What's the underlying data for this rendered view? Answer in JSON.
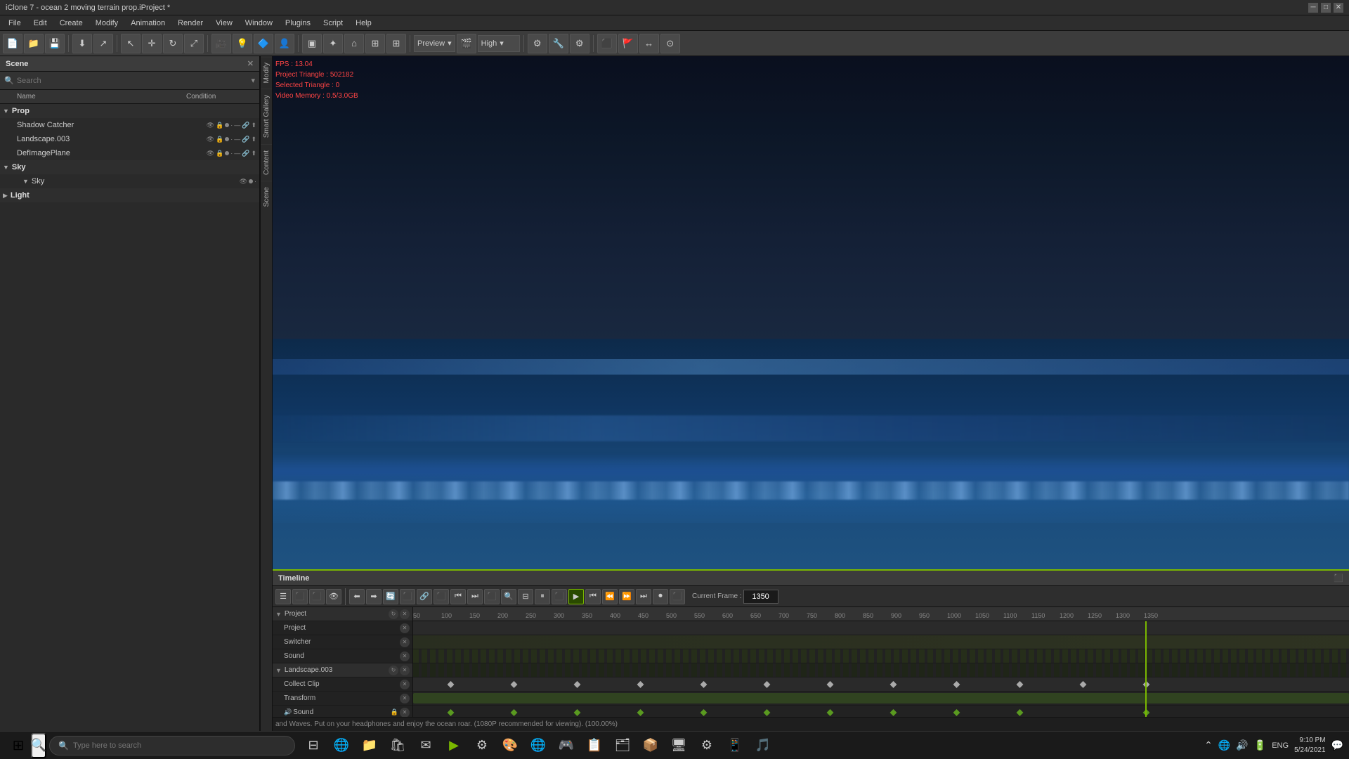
{
  "titleBar": {
    "title": "iClone 7 - ocean 2 moving terrain prop.iProject *",
    "minBtn": "─",
    "maxBtn": "□",
    "closeBtn": "✕"
  },
  "menuBar": {
    "items": [
      "File",
      "Edit",
      "Create",
      "Modify",
      "Animation",
      "Render",
      "View",
      "Window",
      "Plugins",
      "Script",
      "Help"
    ]
  },
  "toolbar": {
    "previewLabel": "Preview",
    "qualityLabel": "High"
  },
  "scenePanel": {
    "title": "Scene",
    "searchPlaceholder": "Search",
    "columnName": "Name",
    "columnCondition": "Condition",
    "groups": [
      {
        "name": "Prop",
        "items": [
          "Shadow Catcher",
          "Landscape.003",
          "DefImagePlane"
        ]
      },
      {
        "name": "Sky",
        "items": [
          "Sky"
        ]
      },
      {
        "name": "Light",
        "items": []
      }
    ]
  },
  "sideTabs": [
    "Modify",
    "Smart Gallery",
    "Content",
    "Scene"
  ],
  "viewport": {
    "fps": "FPS : 13.04",
    "projectTriangle": "Project Triangle : 502182",
    "selectedTriangle": "Selected Triangle : 0",
    "videoMemory": "Video Memory : 0.5/3.0GB"
  },
  "timeline": {
    "title": "Timeline",
    "currentFrameLabel": "Current Frame :",
    "currentFrame": "1350",
    "rulerMarks": [
      50,
      100,
      150,
      200,
      250,
      300,
      350,
      400,
      450,
      500,
      550,
      600,
      650,
      700,
      750,
      800,
      850,
      900,
      950,
      1000,
      1050,
      1100,
      1150,
      1200,
      1250,
      1300,
      1350
    ],
    "tracks": [
      {
        "name": "Project",
        "type": "group"
      },
      {
        "name": "Project",
        "type": "child"
      },
      {
        "name": "Switcher",
        "type": "child"
      },
      {
        "name": "Sound",
        "type": "child"
      },
      {
        "name": "Landscape.003",
        "type": "group"
      },
      {
        "name": "Collect Clip",
        "type": "child"
      },
      {
        "name": "Transform",
        "type": "child"
      },
      {
        "name": "Sound",
        "type": "child"
      }
    ],
    "soundText": "and Waves. Put on your headphones and enjoy the ocean roar. (1080P recommended for viewing). (100.00%)"
  },
  "taskbar": {
    "searchPlaceholder": "Type here to search",
    "time": "9:10 PM",
    "date": "5/24/2021",
    "language": "ENG"
  }
}
